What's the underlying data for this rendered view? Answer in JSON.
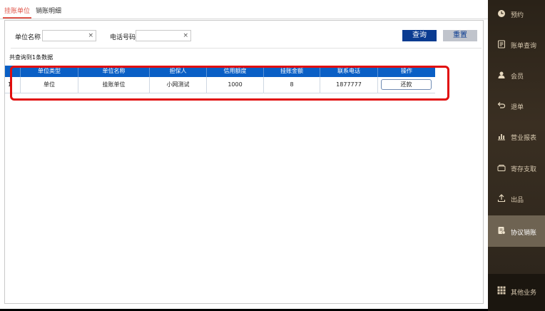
{
  "tabs": [
    {
      "label": "挂账单位",
      "active": true
    },
    {
      "label": "销账明细",
      "active": false
    }
  ],
  "search": {
    "unit_name_label": "单位名称",
    "unit_name_value": "",
    "phone_label": "电话号码",
    "phone_value": "",
    "clear_glyph": "×",
    "search_label": "查询",
    "reset_label": "重置"
  },
  "result_count": "共查询到1条数据",
  "table": {
    "columns": [
      "单位类型",
      "单位名称",
      "担保人",
      "信用额度",
      "挂账金额",
      "联系电话",
      "操作"
    ],
    "rows": [
      {
        "index": "1",
        "type": "单位",
        "name": "挂账单位",
        "guarantor": "小网测试",
        "credit": "1000",
        "amount": "8",
        "phone": "1877777",
        "action": "还款"
      }
    ]
  },
  "sidebar": {
    "items": [
      {
        "label": "预约",
        "icon": "clock-icon"
      },
      {
        "label": "账单查询",
        "icon": "bill-icon"
      },
      {
        "label": "会员",
        "icon": "member-icon"
      },
      {
        "label": "退单",
        "icon": "refund-icon"
      },
      {
        "label": "营业报表",
        "icon": "report-icon"
      },
      {
        "label": "寄存支取",
        "icon": "storage-icon"
      },
      {
        "label": "出品",
        "icon": "output-icon"
      },
      {
        "label": "协议销账",
        "icon": "agreement-icon",
        "active": true
      }
    ],
    "other": {
      "label": "其他业务",
      "icon": "grid-icon"
    }
  },
  "colors": {
    "accent_tab": "#e0554a",
    "header_blue": "#0a5fc5",
    "search_button": "#0b3c91",
    "highlight_red": "#e10e0e"
  }
}
